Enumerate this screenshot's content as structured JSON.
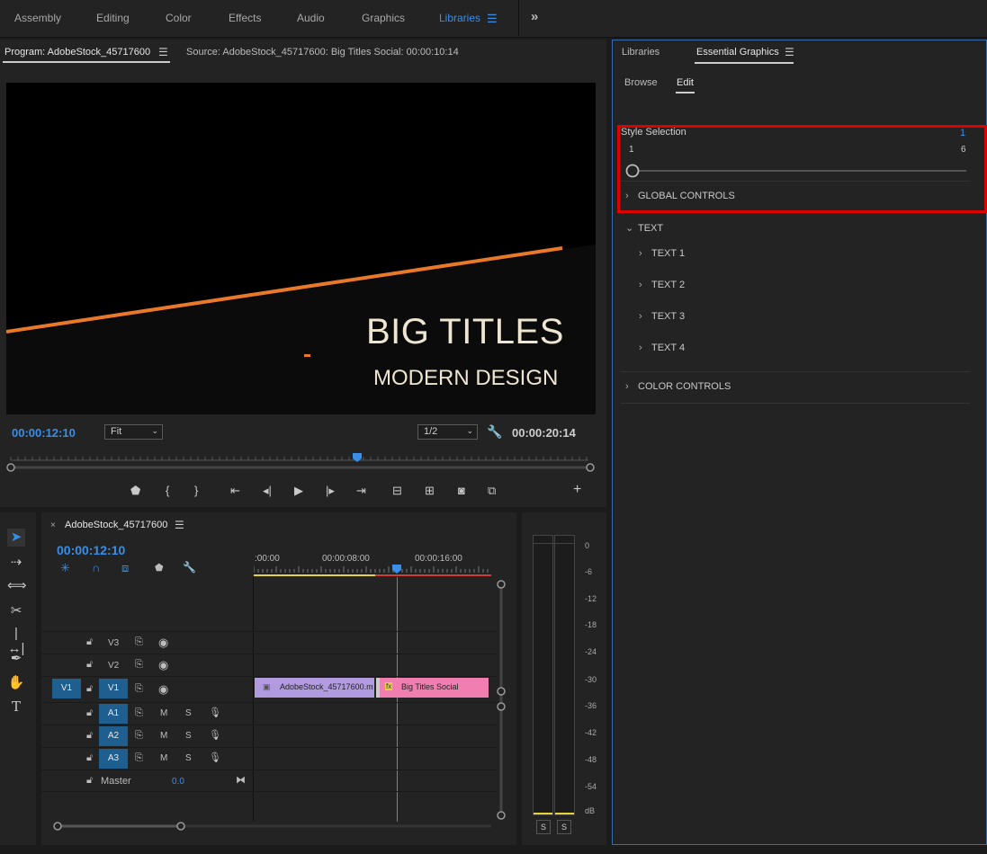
{
  "workspaces": [
    "Assembly",
    "Editing",
    "Color",
    "Effects",
    "Audio",
    "Graphics",
    "Libraries"
  ],
  "active_workspace": "Libraries",
  "program": {
    "tab_label": "Program: AdobeStock_45717600",
    "source_label": "Source: AdobeStock_45717600: Big Titles Social: 00:00:10:14",
    "title_main": "BIG TITLES",
    "title_sub": "MODERN DESIGN",
    "timecode_current": "00:00:12:10",
    "zoom_value": "Fit",
    "resolution_value": "1/2",
    "duration": "00:00:20:14",
    "playhead_fraction": 0.6
  },
  "timeline": {
    "sequence_name": "AdobeStock_45717600",
    "timecode": "00:00:12:10",
    "ruler": [
      ":00:00",
      "00:00:08:00",
      "00:00:16:00"
    ],
    "tracks": {
      "v3": "V3",
      "v2": "V2",
      "v1": "V1",
      "v1_src": "V1",
      "a1": "A1",
      "a2": "A2",
      "a3": "A3",
      "master": "Master",
      "master_value": "0.0",
      "m": "M",
      "s": "S"
    },
    "clips": {
      "video_clip": "AdobeStock_45717600.m",
      "graphic_clip": "Big Titles Social"
    }
  },
  "meter": {
    "scale": [
      "0",
      "-6",
      "-12",
      "-18",
      "-24",
      "-30",
      "-36",
      "-42",
      "-48",
      "-54",
      "dB"
    ],
    "solo_left": "S",
    "solo_right": "S"
  },
  "panel": {
    "tabs": [
      "Libraries",
      "Essential Graphics"
    ],
    "subtabs": [
      "Browse",
      "Edit"
    ],
    "style_selection": {
      "label": "Style Selection",
      "value": "1",
      "min": "1",
      "max": "6"
    },
    "sections": {
      "global": "GLOBAL CONTROLS",
      "text": "TEXT",
      "text_items": [
        "TEXT 1",
        "TEXT 2",
        "TEXT 3",
        "TEXT 4"
      ],
      "color": "COLOR CONTROLS"
    }
  },
  "colors": {
    "accent": "#3a8ee6",
    "highlight": "#e00000",
    "title": "#efe6d2",
    "orange_line": "#e8782a",
    "clip_video": "#b19ae0",
    "clip_graphic": "#f07eb0"
  }
}
